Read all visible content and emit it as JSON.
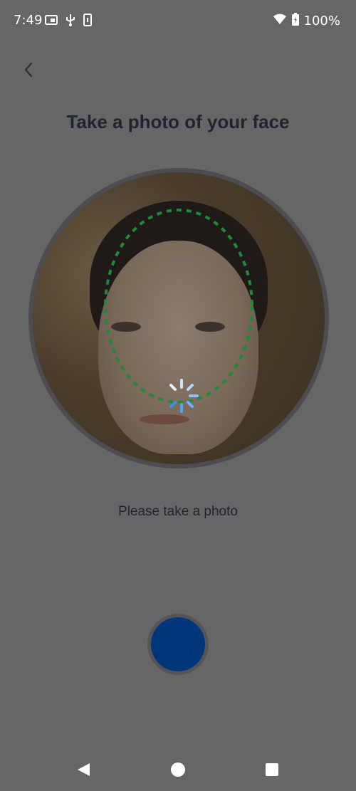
{
  "status_bar": {
    "time": "7:49",
    "battery": "100%",
    "icons_left": [
      "cast-icon",
      "usb-icon",
      "phone-storage-icon"
    ],
    "icons_right": [
      "wifi-icon",
      "battery-charging-icon"
    ]
  },
  "header": {
    "back_icon": "chevron-left-icon",
    "title": "Take a photo of your face"
  },
  "camera": {
    "guide_color": "#1e8a3a",
    "spinner_color": "#4fa6ff"
  },
  "instruction": "Please take a photo",
  "capture": {
    "button_color": "#00377a"
  },
  "nav_bar": {
    "items": [
      "back-triangle-icon",
      "home-circle-icon",
      "recents-square-icon"
    ]
  }
}
